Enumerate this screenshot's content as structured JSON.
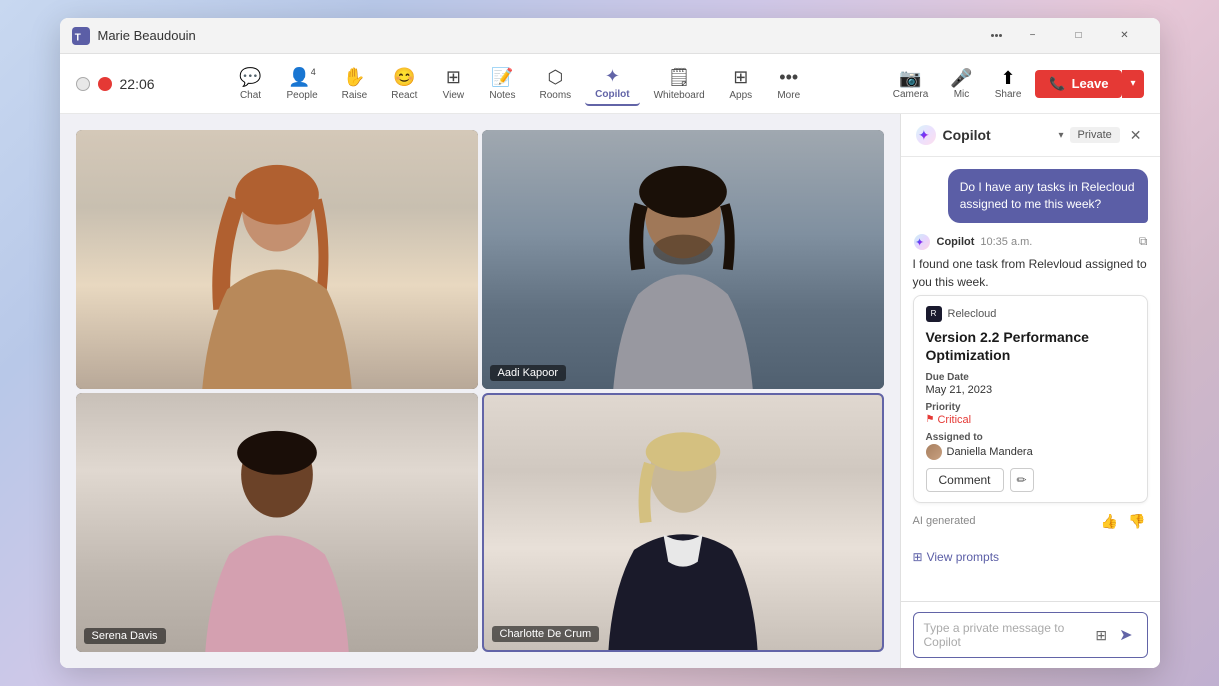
{
  "window": {
    "title": "Marie Beaudouin",
    "controls": [
      "minimize",
      "maximize",
      "close"
    ]
  },
  "toolbar": {
    "timer": "22:06",
    "items": [
      {
        "id": "chat",
        "label": "Chat",
        "icon": "💬"
      },
      {
        "id": "people",
        "label": "People",
        "icon": "👤",
        "badge": "4"
      },
      {
        "id": "raise",
        "label": "Raise",
        "icon": "✋"
      },
      {
        "id": "react",
        "label": "React",
        "icon": "😊"
      },
      {
        "id": "view",
        "label": "View",
        "icon": "⊞"
      },
      {
        "id": "notes",
        "label": "Notes",
        "icon": "📝"
      },
      {
        "id": "rooms",
        "label": "Rooms",
        "icon": "⬡"
      },
      {
        "id": "copilot",
        "label": "Copilot",
        "icon": "✦",
        "active": true
      },
      {
        "id": "whiteboard",
        "label": "Whiteboard",
        "icon": "⬜"
      },
      {
        "id": "apps",
        "label": "Apps",
        "icon": "⊞"
      },
      {
        "id": "more",
        "label": "More",
        "icon": "···"
      }
    ],
    "camera_label": "Camera",
    "mic_label": "Mic",
    "share_label": "Share",
    "leave_label": "Leave"
  },
  "video_tiles": [
    {
      "id": "tile1",
      "name": null,
      "active": false
    },
    {
      "id": "tile2",
      "name": "Aadi Kapoor",
      "active": false
    },
    {
      "id": "tile3",
      "name": "Serena Davis",
      "active": false
    },
    {
      "id": "tile4",
      "name": "Charlotte De Crum",
      "active": true
    }
  ],
  "copilot": {
    "title": "Copilot",
    "private_label": "Private",
    "user_message": "Do I have any tasks in Relecloud assigned to me this week?",
    "bot_name": "Copilot",
    "bot_time": "10:35 a.m.",
    "bot_response": "I found one task from Relevloud assigned to you this week.",
    "task": {
      "app_name": "Relecloud",
      "title": "Version 2.2 Performance Optimization",
      "due_date_label": "Due Date",
      "due_date": "May 21, 2023",
      "priority_label": "Priority",
      "priority": "Critical",
      "assigned_to_label": "Assigned to",
      "assigned_to": "Daniella Mandera",
      "comment_btn": "Comment",
      "edit_btn": "✏"
    },
    "ai_generated": "AI generated",
    "view_prompts": "View prompts",
    "input_placeholder": "Type a private message to Copilot"
  }
}
